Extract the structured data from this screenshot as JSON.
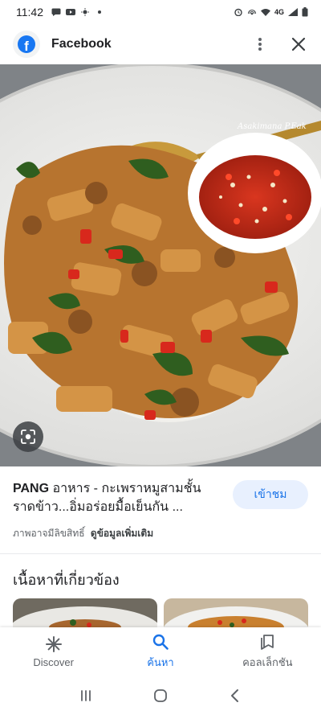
{
  "status_bar": {
    "time": "11:42",
    "network": "4G",
    "icons_left": [
      "message-icon",
      "youtube-icon",
      "weather-icon",
      "dot-icon"
    ],
    "icons_right": [
      "alarm-icon",
      "hotspot-icon",
      "wifi-icon",
      "signal-icon",
      "battery-icon"
    ]
  },
  "app_bar": {
    "title": "Facebook",
    "logo_letter": "f",
    "icons": [
      "facebook-logo-icon",
      "more-vert-icon",
      "close-icon"
    ]
  },
  "image": {
    "watermark": "Asakimana P.Eak",
    "lens_icon": "google-lens-icon"
  },
  "caption": {
    "source": "PANG",
    "title": "อาหาร - กะเพราหมูสามชั้นราดข้าว...อิ่มอร่อยมื้อเย็นกัน ...",
    "visit_label": "เข้าชม",
    "notice": "ภาพอาจมีลิขสิทธิ์",
    "notice_link": "ดูข้อมูลเพิ่มเติม"
  },
  "related": {
    "title": "เนื้อหาที่เกี่ยวข้อง"
  },
  "bottom_nav": {
    "items": [
      {
        "label": "Discover",
        "icon": "discover-asterisk-icon",
        "active": false
      },
      {
        "label": "ค้นหา",
        "icon": "search-icon",
        "active": true
      },
      {
        "label": "คอลเล็กชัน",
        "icon": "collections-icon",
        "active": false
      }
    ]
  },
  "system_nav": {
    "icons": [
      "recents-icon",
      "home-icon",
      "back-icon"
    ]
  },
  "colors": {
    "accent": "#1a73e8",
    "accent_bg": "#e8f0fe",
    "facebook_blue": "#1877f2",
    "text_primary": "#202124",
    "text_secondary": "#5f6368"
  }
}
